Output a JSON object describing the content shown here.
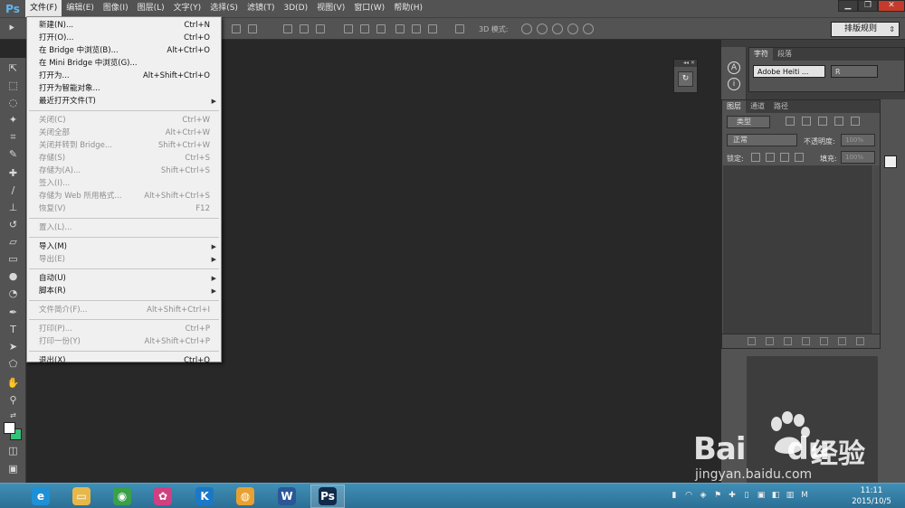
{
  "app": {
    "logo": "Ps"
  },
  "menubar": {
    "items": [
      "文件(F)",
      "编辑(E)",
      "图像(I)",
      "图层(L)",
      "文字(Y)",
      "选择(S)",
      "滤镜(T)",
      "3D(D)",
      "视图(V)",
      "窗口(W)",
      "帮助(H)"
    ],
    "active_index": 0
  },
  "window_controls": {
    "minimize": "▁",
    "restore": "❐",
    "close": "✕"
  },
  "optbar": {
    "mode3d_label": "3D 模式:",
    "workspace": "排版规则"
  },
  "file_menu": {
    "items": [
      {
        "label": "新建(N)...",
        "shortcut": "Ctrl+N",
        "disabled": false
      },
      {
        "label": "打开(O)...",
        "shortcut": "Ctrl+O",
        "disabled": false
      },
      {
        "label": "在 Bridge 中浏览(B)...",
        "shortcut": "Alt+Ctrl+O",
        "disabled": false
      },
      {
        "label": "在 Mini Bridge 中浏览(G)...",
        "shortcut": "",
        "disabled": false
      },
      {
        "label": "打开为...",
        "shortcut": "Alt+Shift+Ctrl+O",
        "disabled": false
      },
      {
        "label": "打开为智能对象...",
        "shortcut": "",
        "disabled": false
      },
      {
        "label": "最近打开文件(T)",
        "shortcut": "",
        "disabled": false,
        "submenu": true
      },
      {
        "label": "关闭(C)",
        "shortcut": "Ctrl+W",
        "disabled": true
      },
      {
        "label": "关闭全部",
        "shortcut": "Alt+Ctrl+W",
        "disabled": true
      },
      {
        "label": "关闭并转到 Bridge...",
        "shortcut": "Shift+Ctrl+W",
        "disabled": true
      },
      {
        "label": "存储(S)",
        "shortcut": "Ctrl+S",
        "disabled": true
      },
      {
        "label": "存储为(A)...",
        "shortcut": "Shift+Ctrl+S",
        "disabled": true
      },
      {
        "label": "签入(I)...",
        "shortcut": "",
        "disabled": true
      },
      {
        "label": "存储为 Web 所用格式...",
        "shortcut": "Alt+Shift+Ctrl+S",
        "disabled": true
      },
      {
        "label": "恢复(V)",
        "shortcut": "F12",
        "disabled": true
      },
      {
        "label": "置入(L)...",
        "shortcut": "",
        "disabled": true
      },
      {
        "label": "导入(M)",
        "shortcut": "",
        "disabled": false,
        "submenu": true
      },
      {
        "label": "导出(E)",
        "shortcut": "",
        "disabled": true,
        "submenu": true
      },
      {
        "label": "自动(U)",
        "shortcut": "",
        "disabled": false,
        "submenu": true
      },
      {
        "label": "脚本(R)",
        "shortcut": "",
        "disabled": false,
        "submenu": true
      },
      {
        "label": "文件简介(F)...",
        "shortcut": "Alt+Shift+Ctrl+I",
        "disabled": true
      },
      {
        "label": "打印(P)...",
        "shortcut": "Ctrl+P",
        "disabled": true
      },
      {
        "label": "打印一份(Y)",
        "shortcut": "Alt+Shift+Ctrl+P",
        "disabled": true
      },
      {
        "label": "退出(X)",
        "shortcut": "Ctrl+Q",
        "disabled": false
      }
    ]
  },
  "char_panel": {
    "tabs": [
      "字符",
      "段落"
    ],
    "font": "Adobe Heiti ...",
    "style": "R"
  },
  "layers_panel": {
    "tabs": [
      "图层",
      "通道",
      "路径"
    ],
    "filter": "类型",
    "blend": "正常",
    "opacity_label": "不透明度:",
    "opacity_value": "100%",
    "lock_label": "锁定:",
    "fill_label": "填充:",
    "fill_value": "100%"
  },
  "taskbar": {
    "apps": [
      {
        "name": "ie-icon",
        "glyph": "e",
        "color": "#1e90d6"
      },
      {
        "name": "explorer-icon",
        "glyph": "▭",
        "color": "#e6b84a"
      },
      {
        "name": "chrome-icon",
        "glyph": "◉",
        "color": "#3aa04a"
      },
      {
        "name": "picasa-icon",
        "glyph": "✿",
        "color": "#d04080"
      },
      {
        "name": "kugou-icon",
        "glyph": "K",
        "color": "#1a78c8"
      },
      {
        "name": "paint-icon",
        "glyph": "◍",
        "color": "#e8a030"
      },
      {
        "name": "word-icon",
        "glyph": "W",
        "color": "#2b5797"
      },
      {
        "name": "photoshop-icon",
        "glyph": "Ps",
        "color": "#0f2a4a"
      }
    ],
    "tray": [
      "▮",
      "◠",
      "◈",
      "⚑",
      "✚",
      "▯",
      "▣",
      "◧",
      "▥",
      "M"
    ],
    "time": "11:11",
    "date": "2015/10/5"
  },
  "watermark": {
    "brand": "Bai",
    "brand2": "du",
    "cn": "经验",
    "url": "jingyan.baidu.com"
  }
}
